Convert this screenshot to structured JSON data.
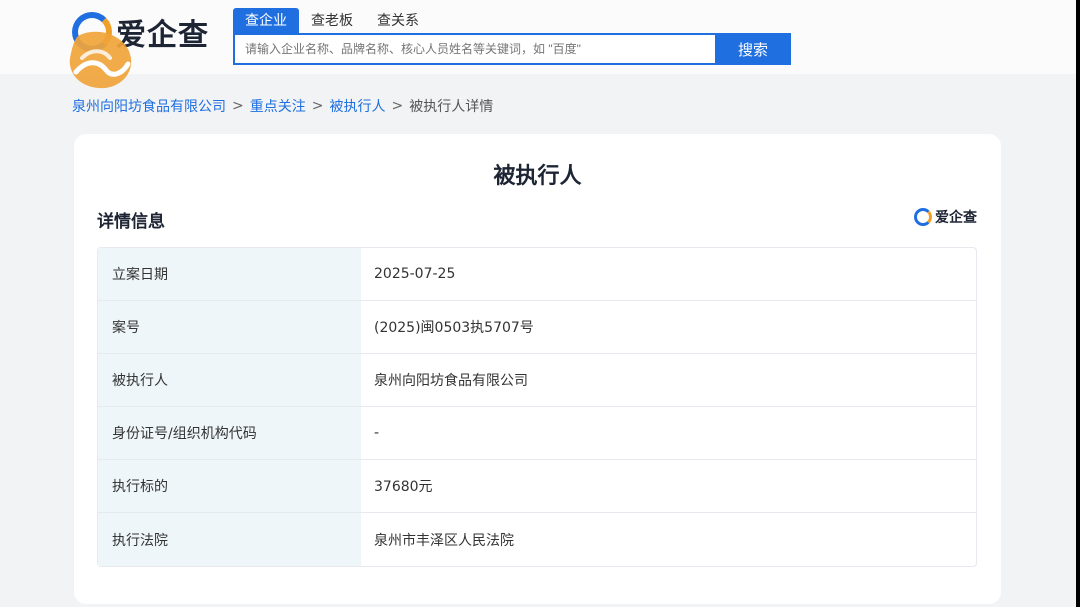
{
  "header": {
    "logo_text": "爱企查",
    "tabs": [
      {
        "label": "查企业",
        "active": true
      },
      {
        "label": "查老板",
        "active": false
      },
      {
        "label": "查关系",
        "active": false
      }
    ],
    "search": {
      "placeholder": "请输入企业名称、品牌名称、核心人员姓名等关键词，如 \"百度\"",
      "button_label": "搜索"
    }
  },
  "breadcrumb": {
    "items": [
      "泉州向阳坊食品有限公司",
      "重点关注",
      "被执行人"
    ],
    "separator": ">",
    "current": "被执行人详情"
  },
  "card": {
    "title": "被执行人",
    "section_title": "详情信息",
    "brand_badge": "爱企查",
    "rows": [
      {
        "label": "立案日期",
        "value": "2025-07-25"
      },
      {
        "label": "案号",
        "value": "(2025)闽0503执5707号"
      },
      {
        "label": "被执行人",
        "value": "泉州向阳坊食品有限公司"
      },
      {
        "label": "身份证号/组织机构代码",
        "value": "-"
      },
      {
        "label": "执行标的",
        "value": "37680元"
      },
      {
        "label": "执行法院",
        "value": "泉州市丰泽区人民法院"
      }
    ]
  },
  "colors": {
    "accent": "#1f6fe0",
    "label_bg": "#eef6fa",
    "page_bg": "#f2f3f5",
    "logo_orange": "#f0a028"
  },
  "icons": [
    "logo-icon",
    "chevron-right-icon",
    "brand-logo-icon",
    "watermark-logo"
  ]
}
